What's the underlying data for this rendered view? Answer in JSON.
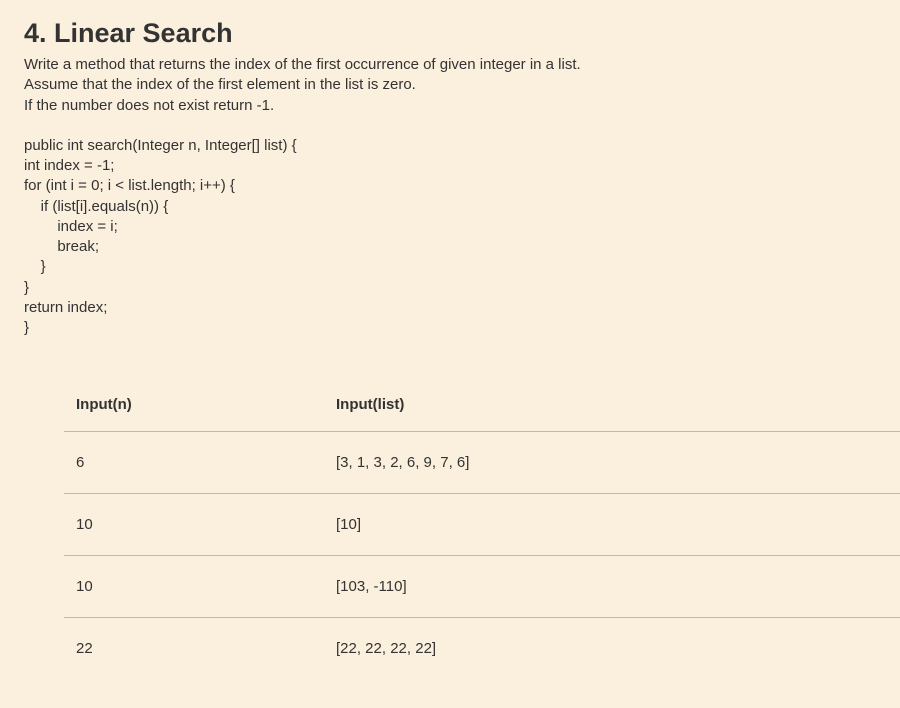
{
  "heading": "4. Linear Search",
  "description": "Write a method that returns the index of the first occurrence of given integer in a list.\nAssume that the index of the first element in the list is zero.\nIf the number does not exist return -1.",
  "code": "public int search(Integer n, Integer[] list) {\nint index = -1;\nfor (int i = 0; i < list.length; i++) {\n    if (list[i].equals(n)) {\n        index = i;\n        break;\n    }\n}\nreturn index;\n}",
  "table": {
    "headers": {
      "col1": "Input(n)",
      "col2": "Input(list)"
    },
    "rows": [
      {
        "n": "6",
        "list": "[3, 1, 3, 2, 6, 9, 7, 6]"
      },
      {
        "n": "10",
        "list": "[10]"
      },
      {
        "n": "10",
        "list": "[103, -110]"
      },
      {
        "n": "22",
        "list": "[22, 22, 22, 22]"
      }
    ]
  }
}
